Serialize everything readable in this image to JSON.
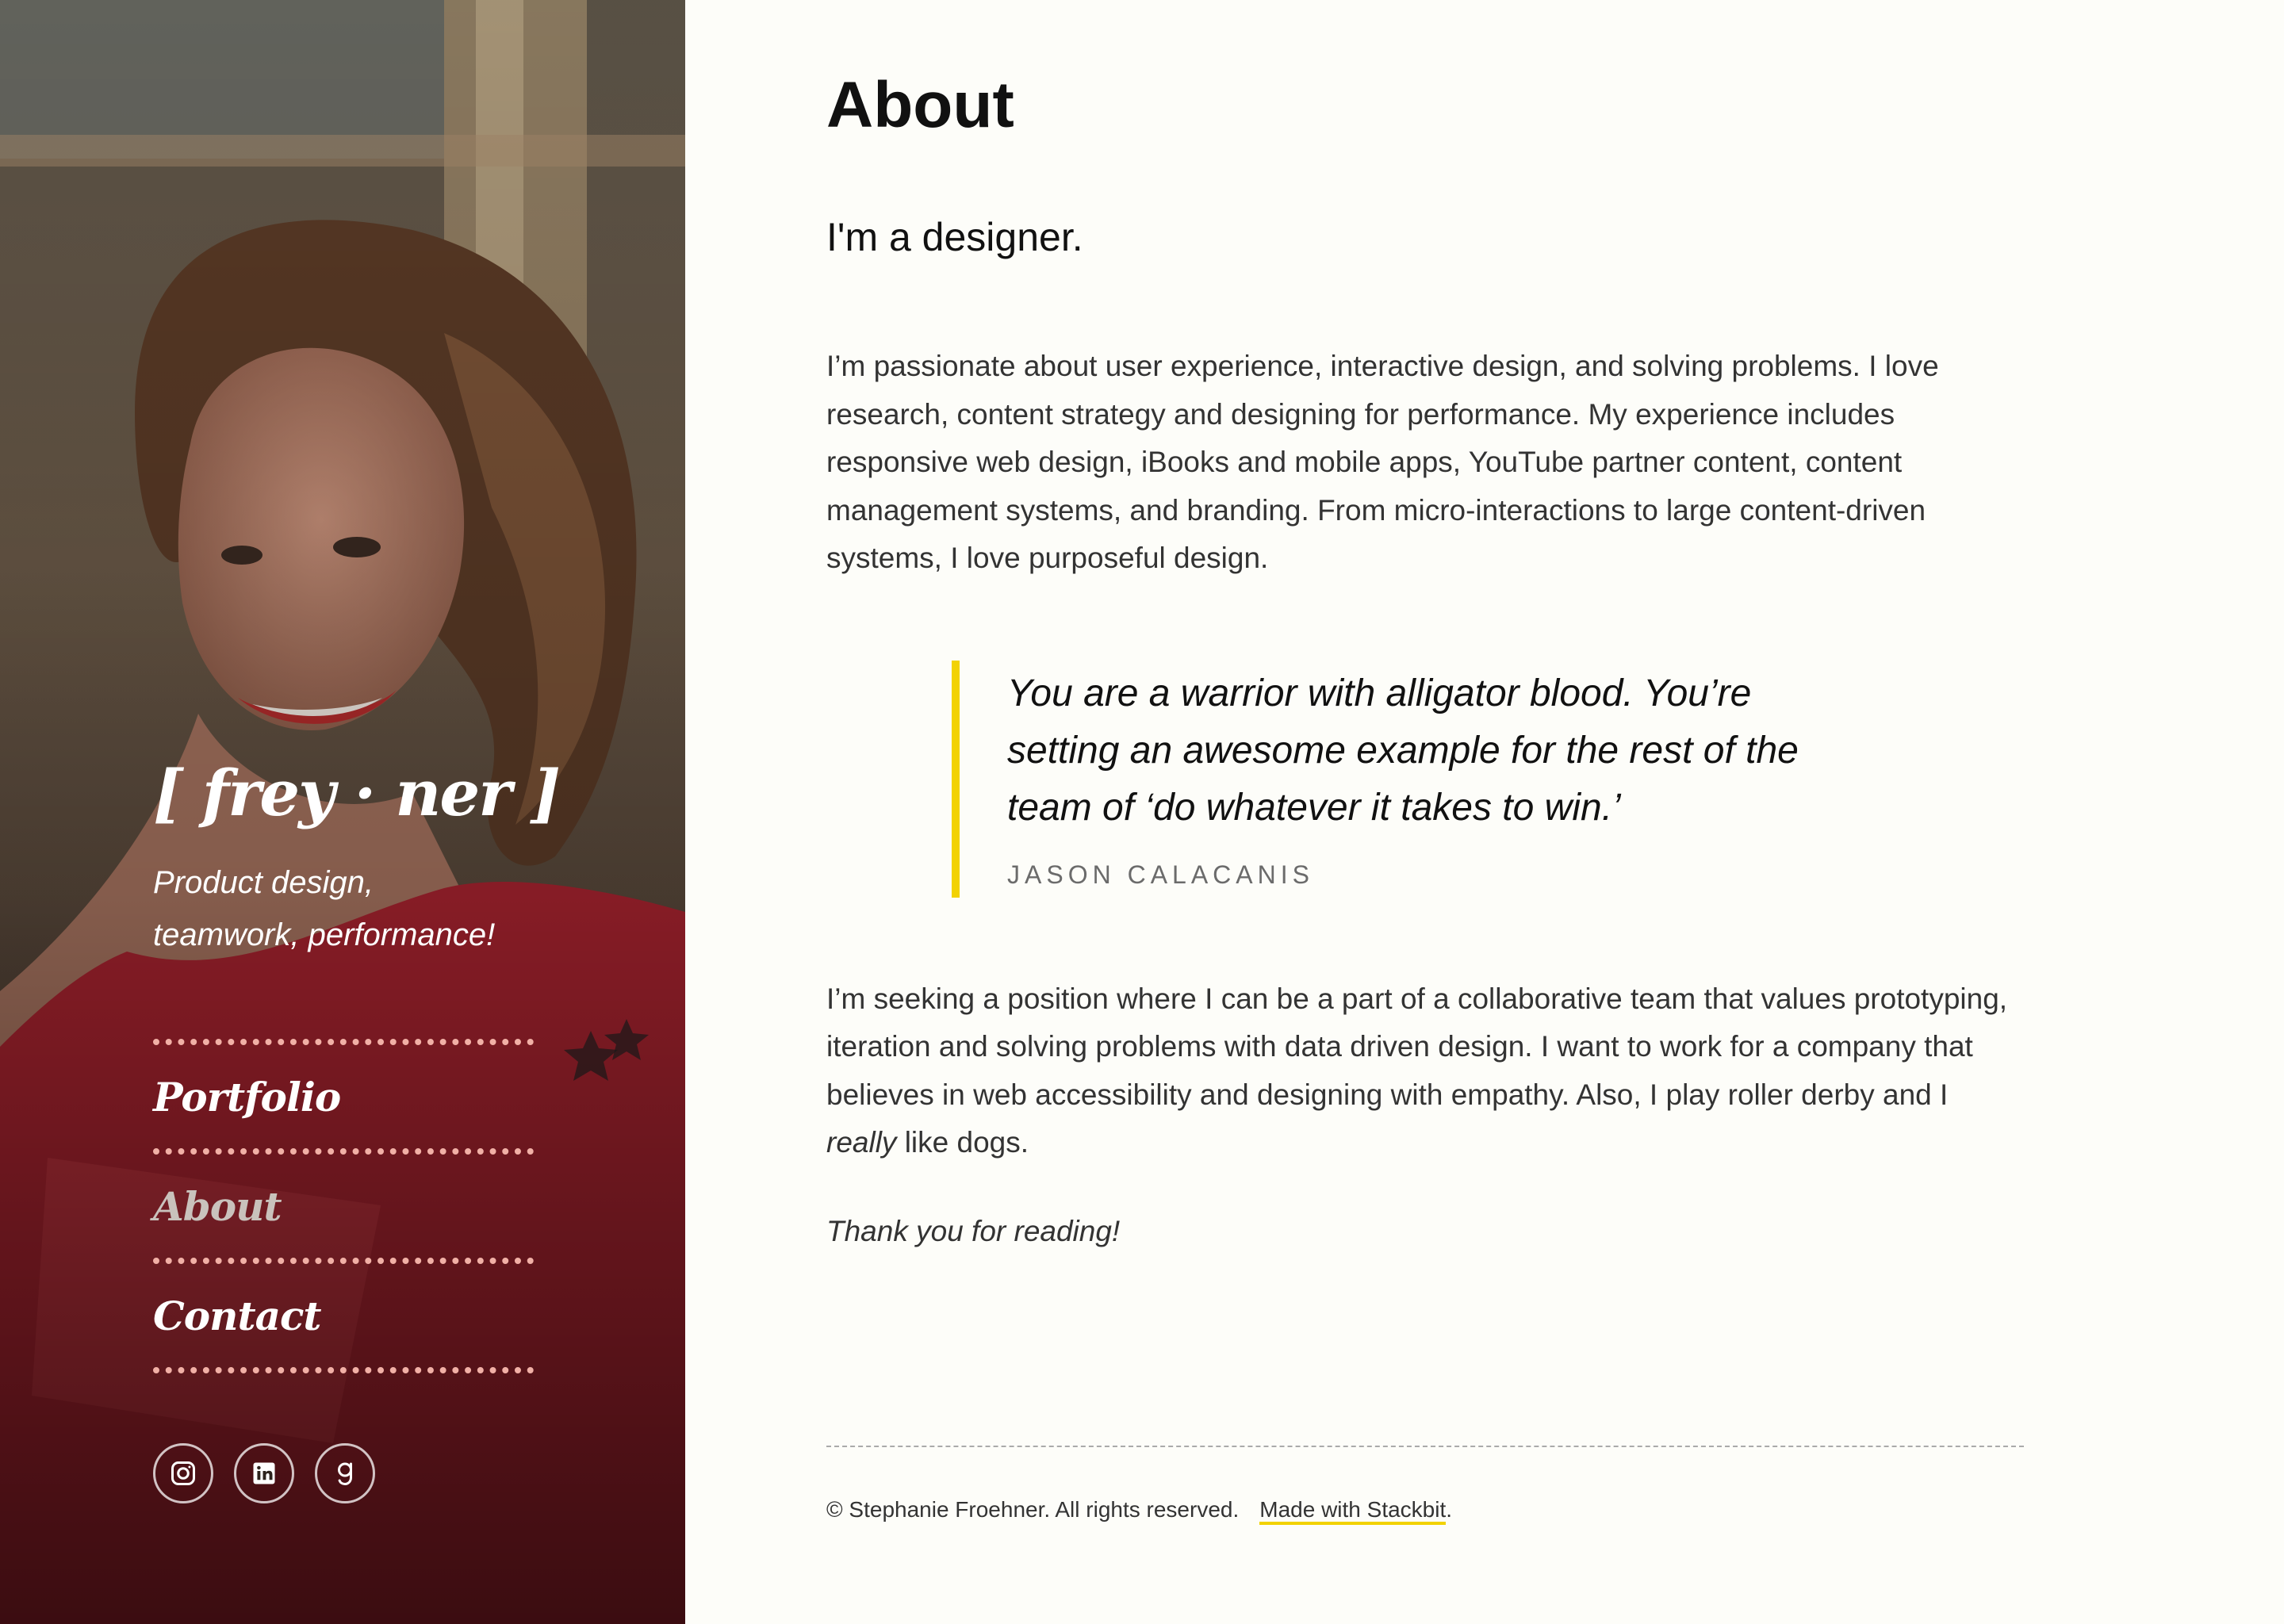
{
  "sidebar": {
    "title": "[ frey · ner ]",
    "tagline_line1": "Product design,",
    "tagline_line2": "teamwork, performance!",
    "nav": [
      {
        "label": "Portfolio",
        "active": false
      },
      {
        "label": "About",
        "active": true
      },
      {
        "label": "Contact",
        "active": false
      }
    ],
    "socials": [
      {
        "icon": "instagram-icon"
      },
      {
        "icon": "linkedin-icon"
      },
      {
        "icon": "goodreads-icon"
      }
    ],
    "separator_color": "#f1b0a6"
  },
  "main": {
    "title": "About",
    "lead": "I'm a designer.",
    "paragraph1": "I’m passionate about user experience, interactive design, and solving problems. I love research, content strategy and designing for performance. My experience includes responsive web design, iBooks and mobile apps, YouTube partner content, content management systems, and branding. From micro-interactions to large content-driven systems, I love purposeful design.",
    "quote": {
      "text": "You are a warrior with alligator blood. You’re setting an awesome example for the rest of the team of ‘do whatever it takes to win.’",
      "cite": "JASON CALACANIS",
      "accent_color": "#f2d203"
    },
    "paragraph2_before": "I’m seeking a position where I can be a part of a collaborative team that values prototyping, iteration and solving problems with data driven design. I want to work for a company that believes in web accessibility and designing with empathy. Also, I play roller derby and I ",
    "paragraph2_emphasis": "really",
    "paragraph2_after": " like dogs.",
    "thanks": "Thank you for reading!"
  },
  "footer": {
    "copyright": "© Stephanie Froehner. All rights reserved.",
    "link_label": "Made with Stackbit",
    "link_suffix": "."
  }
}
